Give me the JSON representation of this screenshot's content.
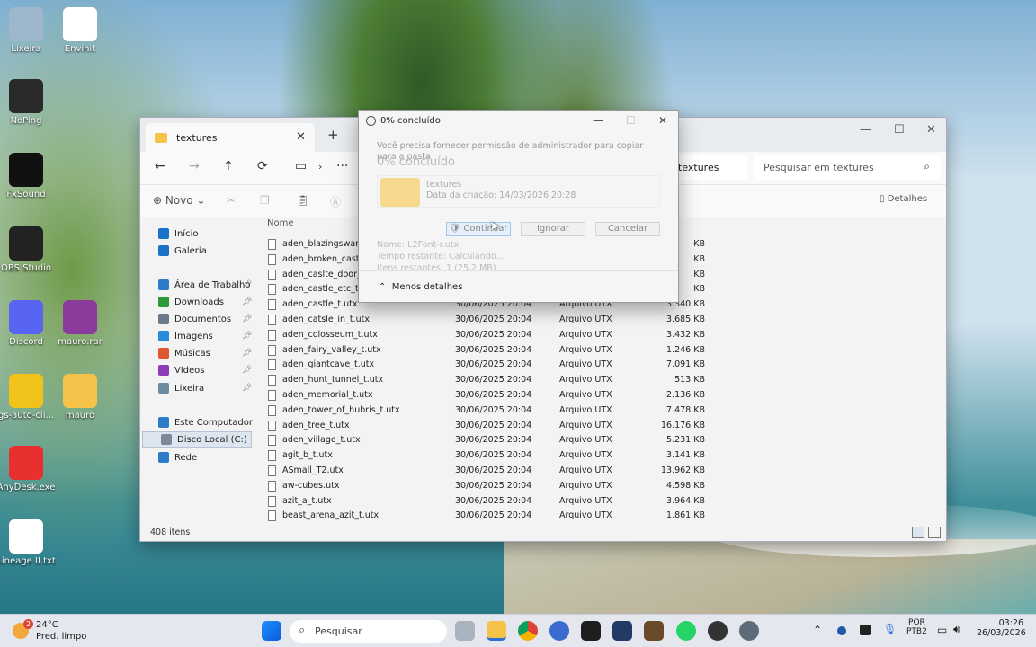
{
  "desktop": {
    "icons": [
      {
        "label": "Lixeira",
        "icon": "recycle-bin-icon",
        "color": "#9fb7cc"
      },
      {
        "label": "Envinit",
        "icon": "document-icon",
        "color": "#ffffff"
      },
      {
        "label": "NoPing",
        "icon": "noping-icon",
        "color": "#2a2a2a"
      },
      {
        "label": "FxSound",
        "icon": "fxsound-icon",
        "color": "#111111"
      },
      {
        "label": "OBS Studio",
        "icon": "obs-icon",
        "color": "#222222"
      },
      {
        "label": "Discord",
        "icon": "discord-icon",
        "color": "#5865f2"
      },
      {
        "label": "mauro.rar",
        "icon": "winrar-icon",
        "color": "#8a3b9c"
      },
      {
        "label": "gs-auto-cli...",
        "icon": "star-icon",
        "color": "#f0c21a"
      },
      {
        "label": "mauro",
        "icon": "folder-icon",
        "color": "#f5c24a"
      },
      {
        "label": "AnyDesk.exe",
        "icon": "anydesk-icon",
        "color": "#e8312f"
      },
      {
        "label": "Lineage II.txt",
        "icon": "text-file-icon",
        "color": "#ffffff"
      }
    ]
  },
  "explorer": {
    "tab_title": "textures",
    "address_current": "textures",
    "search_placeholder": "Pesquisar em textures",
    "toolbar": {
      "new_label": "Novo",
      "details_label": "Detalhes"
    },
    "sidebar": [
      {
        "label": "Início",
        "icon": "home-icon",
        "color": "#1a73c9"
      },
      {
        "label": "Galeria",
        "icon": "gallery-icon",
        "color": "#1a73c9"
      },
      {
        "label": "Área de Trabalho",
        "icon": "desktop-icon",
        "color": "#2c7bc9",
        "pinned": true
      },
      {
        "label": "Downloads",
        "icon": "download-icon",
        "color": "#2b9a3b",
        "pinned": true
      },
      {
        "label": "Documentos",
        "icon": "documents-icon",
        "color": "#6b7a8a",
        "pinned": true
      },
      {
        "label": "Imagens",
        "icon": "images-icon",
        "color": "#2c8bd6",
        "pinned": true
      },
      {
        "label": "Músicas",
        "icon": "music-icon",
        "color": "#e0562f",
        "pinned": true
      },
      {
        "label": "Vídeos",
        "icon": "videos-icon",
        "color": "#8e3bb8",
        "pinned": true
      },
      {
        "label": "Lixeira",
        "icon": "recycle-bin-icon",
        "color": "#6d8aa3",
        "pinned": true
      },
      {
        "label": "Este Computador",
        "icon": "computer-icon",
        "color": "#2c7bc9"
      },
      {
        "label": "Disco Local (C:)",
        "icon": "drive-icon",
        "color": "#7a8a99",
        "selected": true
      },
      {
        "label": "Rede",
        "icon": "network-icon",
        "color": "#2c7bc9"
      }
    ],
    "column_name": "Nome",
    "files": [
      {
        "name": "aden_blazingswamp",
        "date": "",
        "type": "",
        "size": "KB"
      },
      {
        "name": "aden_broken_castle",
        "date": "",
        "type": "",
        "size": "KB"
      },
      {
        "name": "aden_caslte_door_t.",
        "date": "",
        "type": "",
        "size": "KB"
      },
      {
        "name": "aden_castle_etc_t.ut",
        "date": "",
        "type": "",
        "size": "KB"
      },
      {
        "name": "aden_castle_t.utx",
        "date": "30/06/2025 20:04",
        "type": "Arquivo UTX",
        "size": "3.340 KB"
      },
      {
        "name": "aden_catsle_in_t.utx",
        "date": "30/06/2025 20:04",
        "type": "Arquivo UTX",
        "size": "3.685 KB"
      },
      {
        "name": "aden_colosseum_t.utx",
        "date": "30/06/2025 20:04",
        "type": "Arquivo UTX",
        "size": "3.432 KB"
      },
      {
        "name": "aden_fairy_valley_t.utx",
        "date": "30/06/2025 20:04",
        "type": "Arquivo UTX",
        "size": "1.246 KB"
      },
      {
        "name": "aden_giantcave_t.utx",
        "date": "30/06/2025 20:04",
        "type": "Arquivo UTX",
        "size": "7.091 KB"
      },
      {
        "name": "aden_hunt_tunnel_t.utx",
        "date": "30/06/2025 20:04",
        "type": "Arquivo UTX",
        "size": "513 KB"
      },
      {
        "name": "aden_memorial_t.utx",
        "date": "30/06/2025 20:04",
        "type": "Arquivo UTX",
        "size": "2.136 KB"
      },
      {
        "name": "aden_tower_of_hubris_t.utx",
        "date": "30/06/2025 20:04",
        "type": "Arquivo UTX",
        "size": "7.478 KB"
      },
      {
        "name": "aden_tree_t.utx",
        "date": "30/06/2025 20:04",
        "type": "Arquivo UTX",
        "size": "16.176 KB"
      },
      {
        "name": "aden_village_t.utx",
        "date": "30/06/2025 20:04",
        "type": "Arquivo UTX",
        "size": "5.231 KB"
      },
      {
        "name": "agit_b_t.utx",
        "date": "30/06/2025 20:04",
        "type": "Arquivo UTX",
        "size": "3.141 KB"
      },
      {
        "name": "ASmall_T2.utx",
        "date": "30/06/2025 20:04",
        "type": "Arquivo UTX",
        "size": "13.962 KB"
      },
      {
        "name": "aw-cubes.utx",
        "date": "30/06/2025 20:04",
        "type": "Arquivo UTX",
        "size": "4.598 KB"
      },
      {
        "name": "azit_a_t.utx",
        "date": "30/06/2025 20:04",
        "type": "Arquivo UTX",
        "size": "3.964 KB"
      },
      {
        "name": "beast_arena_azit_t.utx",
        "date": "30/06/2025 20:04",
        "type": "Arquivo UTX",
        "size": "1.861 KB"
      }
    ],
    "status": "408 itens"
  },
  "dialog": {
    "title": "0% concluído",
    "ghost_title": "0% concluído",
    "message": "Você precisa fornecer permissão de administrador para copiar para a pasta",
    "folder_name": "textures",
    "folder_date": "Data da criação: 14/03/2026 20:28",
    "continue_label": "Continuar",
    "ignore_label": "Ignorar",
    "cancel_label": "Cancelar",
    "name_line": "Nome:  L2Font-r.utx",
    "time_line": "Tempo restante:  Calculando...",
    "items_line": "Itens restantes:  1 (25,2 MB)",
    "less_details": "Menos detalhes"
  },
  "taskbar": {
    "weather_temp": "24°C",
    "weather_desc": "Pred. limpo",
    "weather_badge": "2",
    "search_label": "Pesquisar",
    "lang_top": "POR",
    "lang_bottom": "PTB2",
    "time": "03:26",
    "date": "26/03/2026"
  }
}
